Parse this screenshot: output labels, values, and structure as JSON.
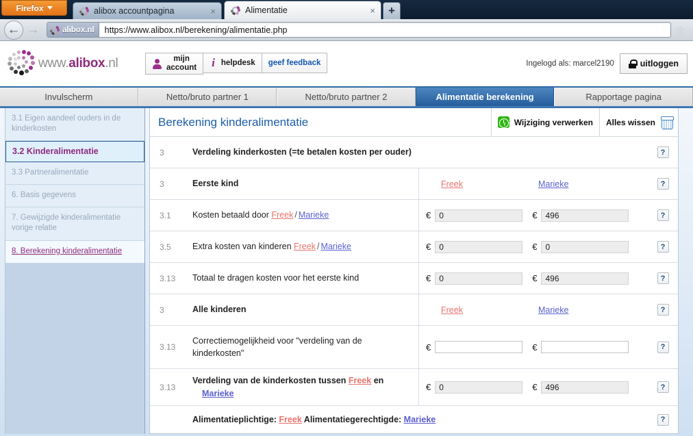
{
  "browser": {
    "firefox_button": "Firefox",
    "tabs": [
      {
        "title": "alibox accountpagina",
        "active": false,
        "close": "×",
        "favicon": "alibox-spinner-icon"
      },
      {
        "title": "Alimentatie",
        "active": true,
        "close": "×",
        "favicon": "alibox-spinner-icon"
      }
    ],
    "new_tab_label": "+",
    "back_glyph": "←",
    "forward_glyph": "→",
    "identity_label": "alibox.nl",
    "url": "https://www.alibox.nl/berekening/alimentatie.php",
    "bookmark_glyph": "☆"
  },
  "header": {
    "logo_text_www": "www.",
    "logo_text_brand": "alibox",
    "logo_text_tld": ".nl",
    "buttons": [
      {
        "line1": "mijn",
        "line2": "account",
        "icon": "person-icon"
      },
      {
        "label": "helpdesk",
        "icon": "info-italic-icon"
      },
      {
        "label": "geef feedback",
        "icon": "none"
      }
    ],
    "logged_in_text": "Ingelogd als: marcel2190",
    "logout_label": "uitloggen",
    "logout_icon": "lock-icon"
  },
  "main_tabs": [
    {
      "label": "Invulscherm",
      "selected": false
    },
    {
      "label": "Netto/bruto partner 1",
      "selected": false
    },
    {
      "label": "Netto/bruto partner 2",
      "selected": false
    },
    {
      "label": "Alimentatie berekening",
      "selected": true
    },
    {
      "label": "Rapportage pagina",
      "selected": false
    }
  ],
  "sidebar": {
    "items": [
      {
        "label": "3.1 Eigen aandeel ouders in de kinderkosten",
        "state": "disabled"
      },
      {
        "label": "3.2 Kinderalimentatie",
        "state": "current"
      },
      {
        "label": "3.3 Partneralimentatie",
        "state": "disabled"
      },
      {
        "label": "6. Basis gegevens",
        "state": "disabled"
      },
      {
        "label": "7. Gewijzigde kinderalimentatie vorige relatie",
        "state": "disabled"
      },
      {
        "label": "8. Berekening kinderalimentatie",
        "state": "link"
      }
    ]
  },
  "content": {
    "title": "Berekening kinderalimentatie",
    "toolbar": {
      "process_label": "Wijziging verwerken",
      "process_icon": "clock-refresh-icon",
      "clear_label": "Alles wissen",
      "clear_icon": "trash-icon"
    },
    "help_glyph": "?",
    "euro": "€",
    "names": {
      "partner1": "Freek",
      "partner2": "Marieke",
      "separator": "/"
    },
    "rows": [
      {
        "num": "3",
        "label_plain": "Verdeling kinderkosten (=te betalen kosten per ouder)",
        "type": "section",
        "bold": true
      },
      {
        "num": "3",
        "label_plain": "Eerste kind",
        "type": "names-header",
        "bold": true,
        "name1": "Freek",
        "name2": "Marieke"
      },
      {
        "num": "3.1",
        "label_prefix": "Kosten betaald door ",
        "label_name1": "Freek",
        "label_sep": "/",
        "label_name2": "Marieke",
        "type": "fields",
        "value1": "0",
        "value2": "496",
        "readonly": true
      },
      {
        "num": "3.5",
        "label_prefix": "Extra kosten van kinderen ",
        "label_name1": "Freek",
        "label_sep": "/",
        "label_name2": "Marieke",
        "type": "fields",
        "value1": "0",
        "value2": "0",
        "readonly": true
      },
      {
        "num": "3.13",
        "label_plain": "Totaal te dragen kosten voor het eerste kind",
        "type": "fields",
        "value1": "0",
        "value2": "496",
        "readonly": true
      },
      {
        "num": "3",
        "label_plain": "Alle kinderen",
        "type": "names-header",
        "bold": true,
        "name1": "Freek",
        "name2": "Marieke"
      },
      {
        "num": "3.13",
        "label_plain": "Correctiemogelijkheid voor \"verdeling van de kinderkosten\"",
        "type": "fields",
        "value1": "",
        "value2": "",
        "readonly": false
      },
      {
        "num": "3.13",
        "label_prefix": "Verdeling van de kinderkosten tussen ",
        "label_name1": "Freek",
        "label_mid": " en ",
        "label_name2": "Marieke",
        "type": "fields",
        "bold": true,
        "value1": "0",
        "value2": "496",
        "readonly": true
      }
    ],
    "footer": {
      "obligated_label": "Alimentatieplichtige:",
      "obligated_name": "Freek",
      "entitled_label": "Alimentatiegerechtigde:",
      "entitled_name": "Marieke"
    }
  },
  "colors": {
    "brand_purple": "#8e2a7e",
    "tab_blue": "#255d9c",
    "title_blue": "#1c5ea8",
    "name1": "#e8736d",
    "name2": "#5b5fd0",
    "accent_green": "#2fb515"
  }
}
